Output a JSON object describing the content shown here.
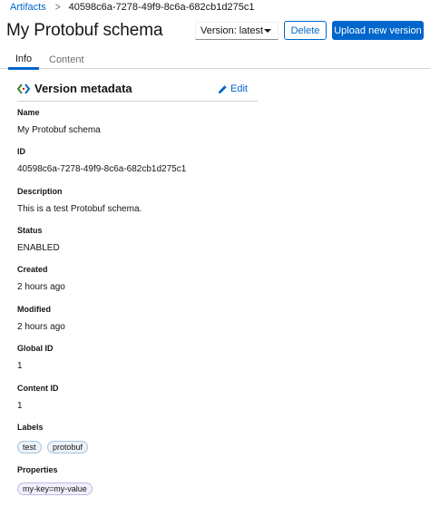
{
  "breadcrumb": {
    "root": "Artifacts",
    "separator": ">",
    "current": "40598c6a-7278-49f9-8c6a-682cb1d275c1"
  },
  "page_title": "My Protobuf schema",
  "toolbar": {
    "version_select": "Version: latest",
    "delete_label": "Delete",
    "upload_label": "Upload new version"
  },
  "tabs": [
    {
      "label": "Info",
      "active": true
    },
    {
      "label": "Content",
      "active": false
    }
  ],
  "card": {
    "title": "Version metadata",
    "edit_label": "Edit",
    "icon": "code-icon"
  },
  "fields": {
    "name": {
      "label": "Name",
      "value": "My Protobuf schema"
    },
    "id": {
      "label": "ID",
      "value": "40598c6a-7278-49f9-8c6a-682cb1d275c1"
    },
    "description": {
      "label": "Description",
      "value": "This is a test Protobuf schema."
    },
    "status": {
      "label": "Status",
      "value": "ENABLED"
    },
    "created": {
      "label": "Created",
      "value": "2 hours ago"
    },
    "modified": {
      "label": "Modified",
      "value": "2 hours ago"
    },
    "global_id": {
      "label": "Global ID",
      "value": "1"
    },
    "content_id": {
      "label": "Content ID",
      "value": "1"
    },
    "labels": {
      "label": "Labels",
      "items": [
        "test",
        "protobuf"
      ]
    },
    "properties": {
      "label": "Properties",
      "items": [
        "my-key=my-value"
      ]
    }
  },
  "colors": {
    "accent": "#0066cc",
    "code_icon_left": "#3e8635",
    "code_icon_right": "#0066cc",
    "code_icon_mid": "#c9190b"
  }
}
